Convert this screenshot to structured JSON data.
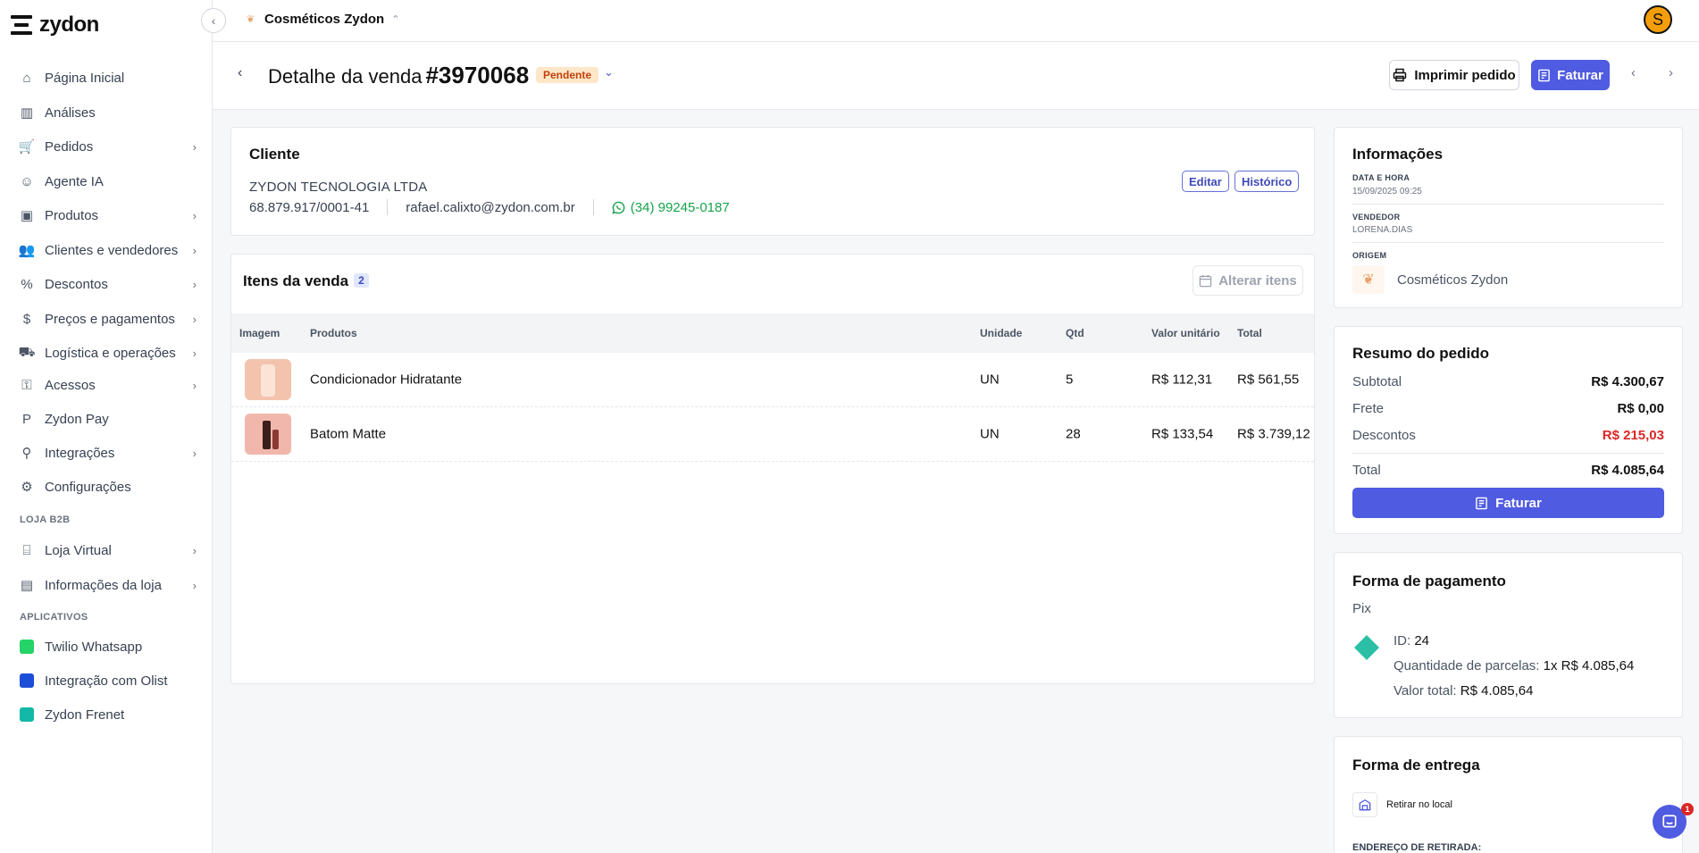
{
  "app": {
    "logo_text": "zydon"
  },
  "topbar": {
    "store_name": "Cosméticos Zydon",
    "avatar_initial": "S"
  },
  "sidebar": {
    "items": [
      {
        "label": "Página Inicial",
        "icon": "home-icon",
        "has_children": false
      },
      {
        "label": "Análises",
        "icon": "chart-icon",
        "has_children": false
      },
      {
        "label": "Pedidos",
        "icon": "cart-icon",
        "has_children": true
      },
      {
        "label": "Agente IA",
        "icon": "robot-icon",
        "has_children": false
      },
      {
        "label": "Produtos",
        "icon": "box-icon",
        "has_children": true
      },
      {
        "label": "Clientes e vendedores",
        "icon": "users-icon",
        "has_children": true
      },
      {
        "label": "Descontos",
        "icon": "discount-icon",
        "has_children": true
      },
      {
        "label": "Preços e pagamentos",
        "icon": "dollar-icon",
        "has_children": true
      },
      {
        "label": "Logística e operações",
        "icon": "truck-icon",
        "has_children": true
      },
      {
        "label": "Acessos",
        "icon": "key-icon",
        "has_children": true
      },
      {
        "label": "Zydon Pay",
        "icon": "pay-icon",
        "has_children": false
      },
      {
        "label": "Integrações",
        "icon": "plug-icon",
        "has_children": true
      },
      {
        "label": "Configurações",
        "icon": "gear-icon",
        "has_children": false
      }
    ],
    "section_b2b": "LOJA B2B",
    "b2b_items": [
      {
        "label": "Loja Virtual",
        "icon": "store-icon",
        "has_children": true
      },
      {
        "label": "Informações da loja",
        "icon": "id-card-icon",
        "has_children": true
      }
    ],
    "section_apps": "APLICATIVOS",
    "apps": [
      {
        "label": "Twilio Whatsapp",
        "color": "#25d366"
      },
      {
        "label": "Integração com Olist",
        "color": "#1d4ed8"
      },
      {
        "label": "Zydon Frenet",
        "color": "#14b8a6"
      }
    ]
  },
  "header": {
    "title_prefix": "Detalhe da venda",
    "order_number": "#3970068",
    "status": "Pendente",
    "print_label": "Imprimir pedido",
    "invoice_label": "Faturar"
  },
  "client": {
    "title": "Cliente",
    "name": "ZYDON TECNOLOGIA LTDA",
    "document": "68.879.917/0001-41",
    "email": "rafael.calixto@zydon.com.br",
    "phone": "(34) 99245-0187",
    "edit_label": "Editar",
    "history_label": "Histórico"
  },
  "items": {
    "title": "Itens da venda",
    "count": "2",
    "alter_label": "Alterar itens",
    "columns": [
      "Imagem",
      "Produtos",
      "Unidade",
      "Qtd",
      "Valor unitário",
      "Total"
    ],
    "rows": [
      {
        "product": "Condicionador Hidratante",
        "unit": "UN",
        "qty": "5",
        "unit_price": "R$ 112,31",
        "total": "R$ 561,55",
        "thumb_color": "#f4c3ae"
      },
      {
        "product": "Batom Matte",
        "unit": "UN",
        "qty": "28",
        "unit_price": "R$ 133,54",
        "total": "R$ 3.739,12",
        "thumb_color": "#f2b7ac"
      }
    ]
  },
  "info": {
    "title": "Informações",
    "datetime_label": "DATA E HORA",
    "datetime_value": "15/09/2025 09:25",
    "seller_label": "VENDEDOR",
    "seller_value": "LORENA.DIAS",
    "origin_label": "ORIGEM",
    "origin_value": "Cosméticos Zydon"
  },
  "summary": {
    "title": "Resumo do pedido",
    "subtotal_label": "Subtotal",
    "subtotal_value": "R$ 4.300,67",
    "freight_label": "Frete",
    "freight_value": "R$ 0,00",
    "discount_label": "Descontos",
    "discount_value": "R$ 215,03",
    "total_label": "Total",
    "total_value": "R$ 4.085,64",
    "invoice_label": "Faturar"
  },
  "payment": {
    "title": "Forma de pagamento",
    "method": "Pix",
    "id_label": "ID:",
    "id_value": "24",
    "installments_label": "Quantidade de parcelas:",
    "installments_value": "1x R$ 4.085,64",
    "total_label": "Valor total:",
    "total_value": "R$ 4.085,64"
  },
  "delivery": {
    "title": "Forma de entrega",
    "method": "Retirar no local",
    "address_label": "ENDEREÇO DE RETIRADA:"
  },
  "chat": {
    "badge": "1"
  },
  "colors": {
    "accent": "#4f5be0",
    "pending_bg": "#fde7c8",
    "pending_text": "#c2410c",
    "whatsapp": "#16a34a",
    "discount": "#dc2626"
  }
}
